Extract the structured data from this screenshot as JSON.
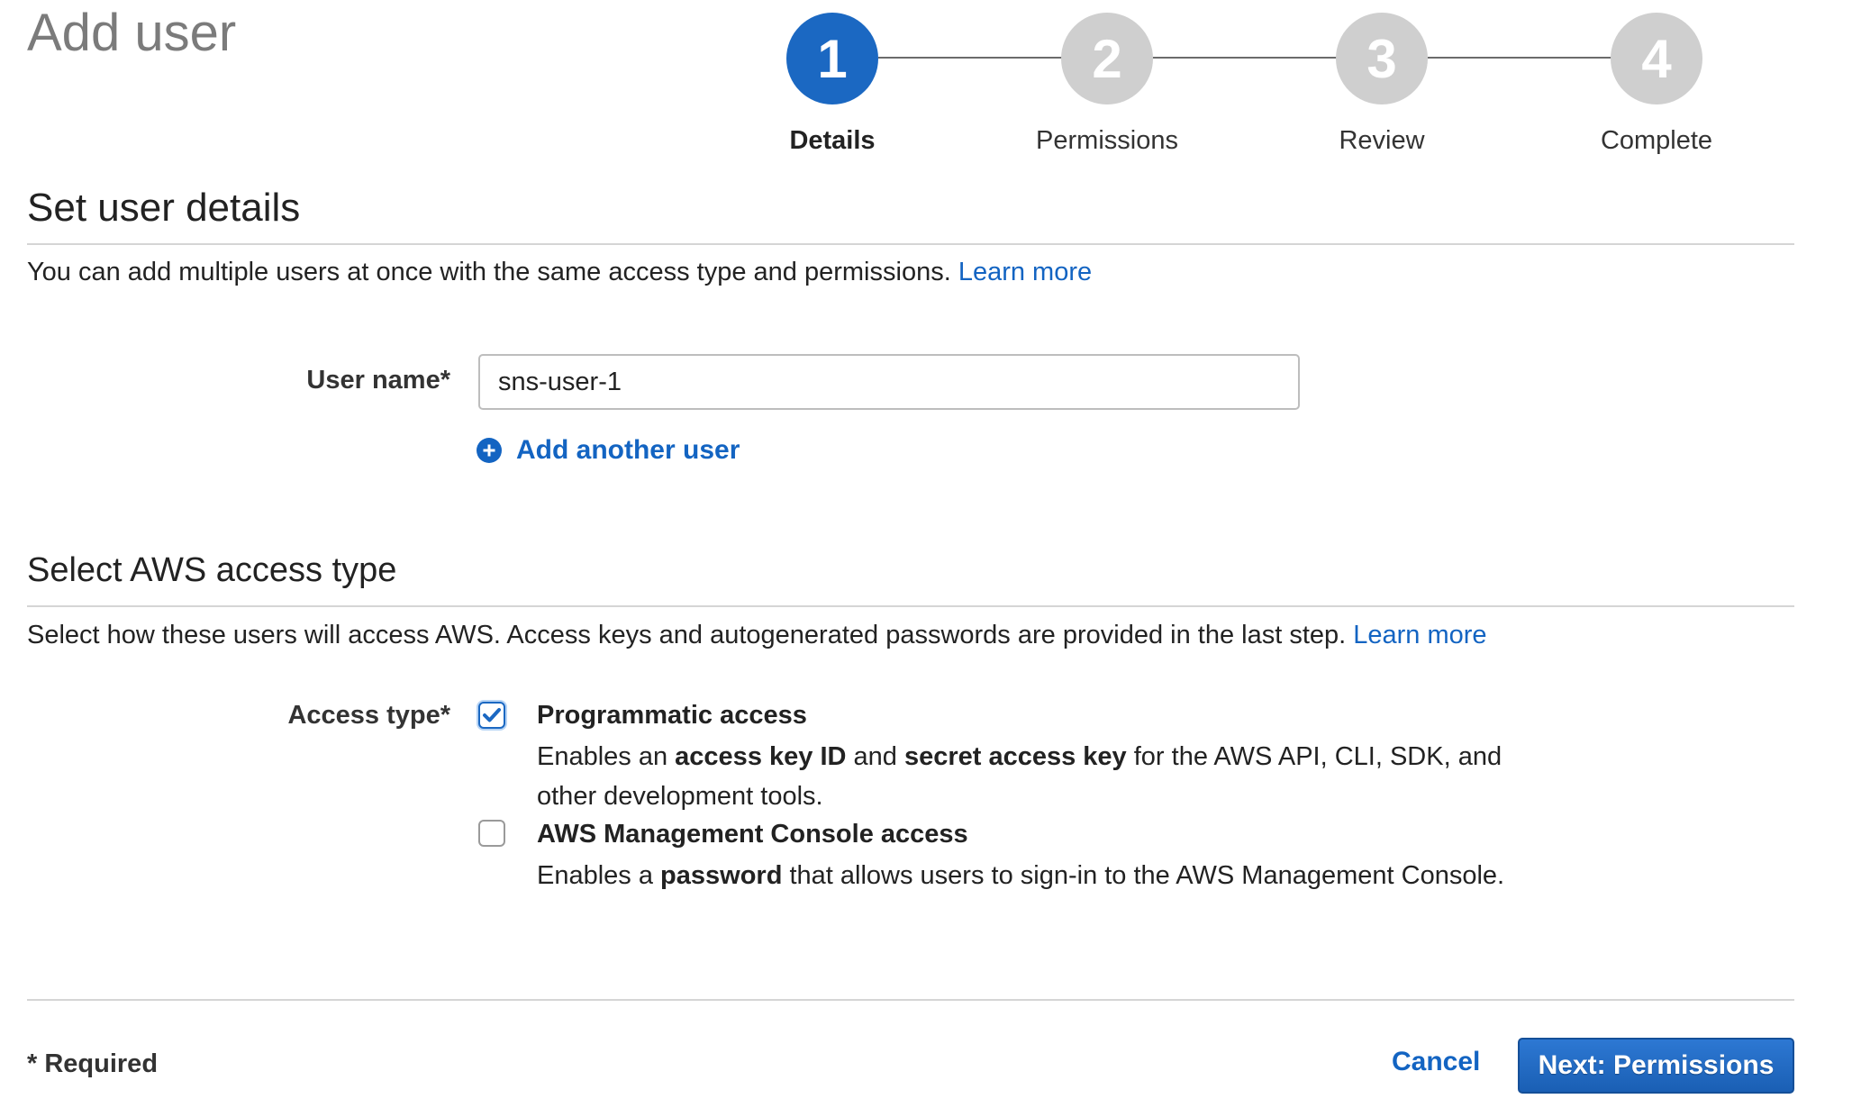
{
  "header": {
    "title": "Add user"
  },
  "stepper": {
    "steps": [
      {
        "number": "1",
        "label": "Details",
        "state": "active"
      },
      {
        "number": "2",
        "label": "Permissions",
        "state": "inactive"
      },
      {
        "number": "3",
        "label": "Review",
        "state": "inactive"
      },
      {
        "number": "4",
        "label": "Complete",
        "state": "inactive"
      }
    ]
  },
  "user_details": {
    "title": "Set user details",
    "description": "You can add multiple users at once with the same access type and permissions.",
    "learn_more": "Learn more",
    "username_label": "User name*",
    "username_value": "sns-user-1",
    "add_another_user": "Add another user"
  },
  "access_type": {
    "title": "Select AWS access type",
    "description": "Select how these users will access AWS. Access keys and autogenerated passwords are provided in the last step.",
    "learn_more": "Learn more",
    "label": "Access type*",
    "options": [
      {
        "title": "Programmatic access",
        "checked": true,
        "desc_parts": [
          "Enables an ",
          "access key ID",
          " and ",
          "secret access key",
          " for the AWS API, CLI, SDK, and other development tools."
        ]
      },
      {
        "title": "AWS Management Console access",
        "checked": false,
        "desc_parts": [
          "Enables a ",
          "password",
          " that allows users to sign-in to the AWS Management Console."
        ]
      }
    ]
  },
  "footer": {
    "required_note": "* Required",
    "cancel_label": "Cancel",
    "next_label": "Next: Permissions"
  },
  "colors": {
    "accent": "#1b68c2",
    "link": "#1364c2",
    "inactive_step": "#cfcfcf"
  },
  "icons": {
    "add_user": "plus-circle-icon",
    "checked": "checkmark-icon"
  }
}
